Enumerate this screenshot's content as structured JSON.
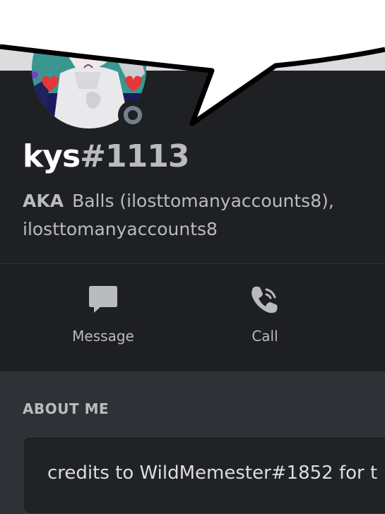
{
  "profile": {
    "username": "kys",
    "discriminator": "#1113",
    "status": "offline",
    "aka_label": "AKA",
    "aka_names": "Balls (ilosttomanyaccounts8), ilosttomanyaccounts8"
  },
  "actions": {
    "message_label": "Message",
    "call_label": "Call"
  },
  "about": {
    "heading": "ABOUT ME",
    "text": "credits to WildMemester#1852 for t"
  },
  "icons": {
    "message": "chat-bubble-icon",
    "call": "phone-call-icon",
    "status": "offline-status-icon"
  },
  "colors": {
    "header_bg": "#1f2024",
    "body_bg": "#2f3136",
    "text_primary": "#ffffff",
    "text_muted": "#b9bbbe",
    "status_offline": "#747f8d"
  }
}
